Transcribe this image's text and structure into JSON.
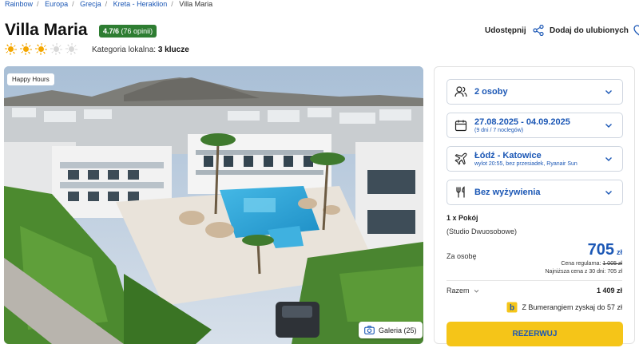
{
  "breadcrumb": {
    "items": [
      "Rainbow",
      "Europa",
      "Grecja",
      "Kreta - Heraklion"
    ],
    "current": "Villa Maria"
  },
  "hotel": {
    "name": "Villa Maria",
    "rating_score": "4.7/6",
    "rating_reviews": "(76 opinii)",
    "suns_filled": 3,
    "suns_total": 5,
    "category_label": "Kategoria lokalna:",
    "category_value": "3 klucze"
  },
  "actions": {
    "share_label": "Udostępnij",
    "favorite_label": "Dodaj do ulubionych"
  },
  "photo": {
    "badge": "Happy Hours",
    "gallery_label": "Galeria (25)"
  },
  "booking": {
    "persons": "2 osoby",
    "dates": "27.08.2025 - 04.09.2025",
    "dates_sub": "(9 dni / 7 noclegów)",
    "flight": "Łódź - Katowice",
    "flight_sub": "wylot 20:55, bez przesiadek, Ryanair Sun",
    "meal": "Bez wyżywienia",
    "room": "1 x Pokój",
    "room_type": "(Studio Dwuosobowe)",
    "per_person_label": "Za osobę",
    "price": "705",
    "currency": "zł",
    "regular_label": "Cena regularna:",
    "regular_price": "1 005 zł",
    "lowest_30": "Najniższa cena z 30 dni: 705 zł",
    "total_label": "Razem",
    "total_value": "1 409 zł",
    "bumerang": "Z Bumerangiem zyskaj do 57 zł",
    "book_label": "REZERWUJ"
  },
  "colors": {
    "brand_blue": "#1b57b5",
    "rating_green": "#2e7d32",
    "cta_yellow": "#f5c518",
    "sun_active": "#f3a600"
  }
}
